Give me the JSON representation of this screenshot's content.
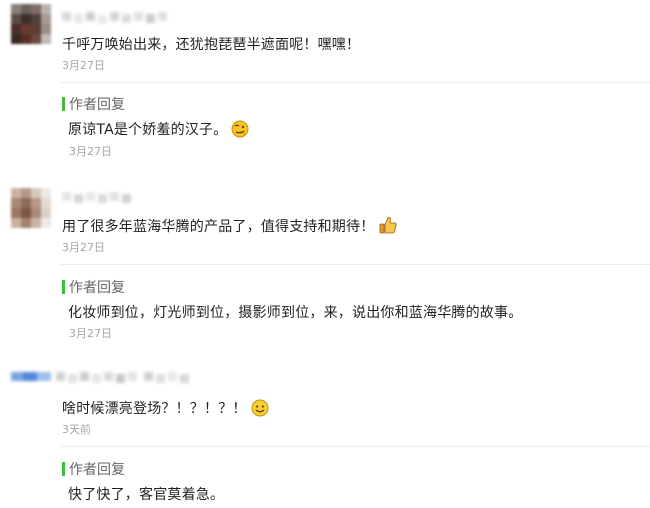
{
  "comments": [
    {
      "text": "千呼万唤始出来，还犹抱琵琶半遮面呢！嘿嘿！",
      "date": "3月27日",
      "reply": {
        "label": "作者回复",
        "text": "原谅TA是个娇羞的汉子。",
        "date": "3月27日",
        "emoji": "smirk-face-icon"
      }
    },
    {
      "text": "用了很多年蓝海华腾的产品了，值得支持和期待！",
      "date": "3月27日",
      "emoji": "thumbs-up-icon",
      "reply": {
        "label": "作者回复",
        "text": "化妆师到位，灯光师到位，摄影师到位，来，说出你和蓝海华腾的故事。",
        "date": "3月27日"
      }
    },
    {
      "text": "啥时候漂亮登场？！？！？！",
      "date": "3天前",
      "emoji": "smile-face-icon",
      "reply": {
        "label": "作者回复",
        "text": "快了快了，客官莫着急。"
      }
    }
  ],
  "colors": {
    "accent_bar": "#3dbd3d",
    "date": "#a6a6a6",
    "divider": "#ececec"
  }
}
